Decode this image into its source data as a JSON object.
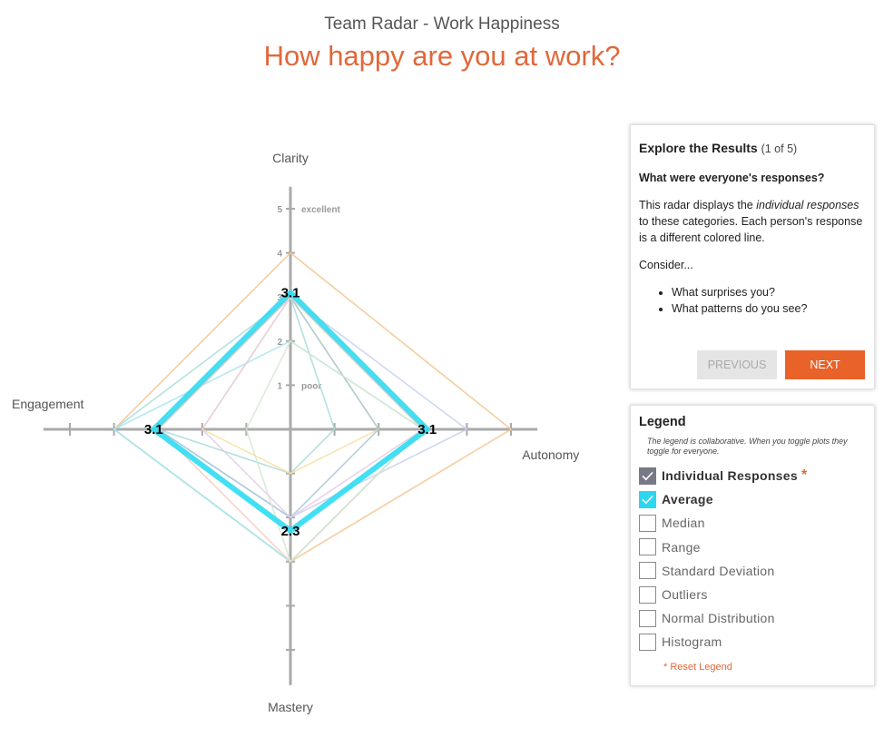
{
  "header": {
    "subtitle": "Team Radar - Work Happiness",
    "title": "How happy are you at work?"
  },
  "chart_data": {
    "type": "radar",
    "axes": [
      "Clarity",
      "Autonomy",
      "Mastery",
      "Engagement"
    ],
    "range": [
      0,
      5
    ],
    "tick_values": [
      1,
      2,
      3,
      4,
      5
    ],
    "tick_labels": [
      "1",
      "2",
      "3",
      "4",
      "5"
    ],
    "tick_annotations": {
      "poor": "poor",
      "excellent": "excellent"
    },
    "series": [
      {
        "name": "Average",
        "values": [
          3.1,
          3.1,
          2.3,
          3.1
        ],
        "color": "#2fdcf2"
      }
    ],
    "individual_responses": [
      {
        "values": [
          4,
          5,
          3,
          4
        ],
        "color": "#f3c48f"
      },
      {
        "values": [
          3,
          4,
          2,
          3
        ],
        "color": "#c8d0ee"
      },
      {
        "values": [
          3,
          3,
          3,
          4
        ],
        "color": "#a6ddd7"
      },
      {
        "values": [
          2,
          3,
          3,
          4
        ],
        "color": "#a9e5ef"
      },
      {
        "values": [
          3,
          1,
          1,
          3
        ],
        "color": "#a6ddd7"
      },
      {
        "values": [
          3,
          2,
          1,
          2
        ],
        "color": "#f8dfa0"
      },
      {
        "values": [
          3,
          2,
          2,
          3
        ],
        "color": "#a6c8d8"
      },
      {
        "values": [
          3,
          3,
          2,
          2
        ],
        "color": "#e3cde8"
      },
      {
        "values": [
          3,
          3,
          3,
          3
        ],
        "color": "#f7ccbe"
      },
      {
        "values": [
          2,
          3,
          3,
          1
        ],
        "color": "#d6e6d0"
      }
    ],
    "data_labels": [
      "3.1",
      "3.1",
      "2.3",
      "3.1"
    ]
  },
  "explore": {
    "heading": "Explore the Results",
    "count": "(1 of 5)",
    "question": "What were everyone's responses?",
    "desc_pre": "This radar displays the ",
    "desc_em": "individual responses",
    "desc_post": " to these categories. Each person's response is a different colored line.",
    "consider": "Consider...",
    "bullets": [
      "What surprises you?",
      "What patterns do you see?"
    ],
    "prev_label": "PREVIOUS",
    "next_label": "NEXT"
  },
  "legend": {
    "heading": "Legend",
    "note": "The legend is collaborative. When you toggle plots they toggle for everyone.",
    "items": [
      {
        "label": "Individual Responses",
        "checked": true
      },
      {
        "label": "Average",
        "checked": true
      },
      {
        "label": "Median",
        "checked": false
      },
      {
        "label": "Range",
        "checked": false
      },
      {
        "label": "Standard Deviation",
        "checked": false
      },
      {
        "label": "Outliers",
        "checked": false
      },
      {
        "label": "Normal Distribution",
        "checked": false
      },
      {
        "label": "Histogram",
        "checked": false
      }
    ],
    "required_mark": "*",
    "reset_label": "* Reset Legend"
  },
  "colors": {
    "accent": "#e0683a",
    "average": "#2fdcf2",
    "axis": "#aaaaaa"
  }
}
